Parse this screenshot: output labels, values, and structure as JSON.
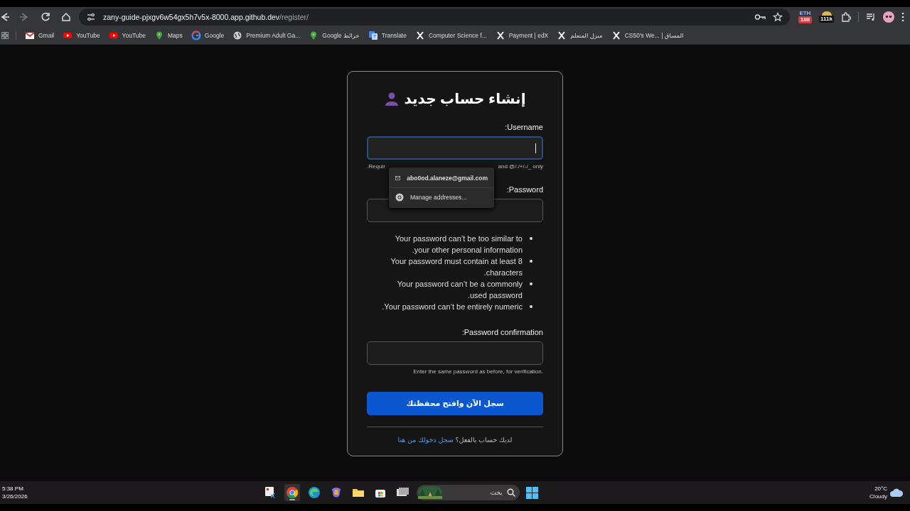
{
  "browser": {
    "nav_buttons": [
      {
        "kind": "back",
        "disabled": false
      },
      {
        "kind": "forward",
        "disabled": true
      },
      {
        "kind": "reload",
        "disabled": false
      },
      {
        "kind": "home",
        "disabled": false
      }
    ],
    "address": {
      "host": "zany-guide-pjxgv6w54gx5h7v5x-8000.app.github.dev",
      "path": "/register/"
    },
    "extensions": [
      {
        "kind": "eth",
        "label": "ETH",
        "badge": "188"
      },
      {
        "kind": "coin",
        "badge": "111k"
      }
    ],
    "bookmarks": [
      {
        "kind": "gmail",
        "label": "Gmail"
      },
      {
        "kind": "youtube",
        "label": "YouTube"
      },
      {
        "kind": "youtube",
        "label": "YouTube"
      },
      {
        "kind": "maps",
        "label": "Maps"
      },
      {
        "kind": "google",
        "label": "Google"
      },
      {
        "kind": "globe",
        "label": "Premium Adult Ga..."
      },
      {
        "kind": "maps",
        "label": "Google خرائط"
      },
      {
        "kind": "translate",
        "label": "Translate"
      },
      {
        "kind": "x",
        "label": "Computer Science f..."
      },
      {
        "kind": "x",
        "label": "Payment | edX"
      },
      {
        "kind": "x",
        "label": "منزل المتعلم"
      },
      {
        "kind": "x",
        "label": "CS50's We... | المساق"
      }
    ]
  },
  "form": {
    "title": "إنشاء حساب جديد",
    "username": {
      "label": "Username:",
      "focused": true,
      "help_left": ".Requir",
      "help_right": "and @/./+/-/_ only"
    },
    "autofill": [
      {
        "kind": "email",
        "label": "abo0od.alaneze@gmail.com"
      },
      {
        "kind": "manage",
        "label": "Manage addresses..."
      }
    ],
    "password": {
      "label": "Password:",
      "focused": false
    },
    "rules": [
      "Your password can’t be too similar to your other personal information.",
      "Your password must contain at least 8 characters.",
      "Your password can’t be a commonly used password.",
      "Your password can’t be entirely numeric."
    ],
    "confirm": {
      "label": "Password confirmation:",
      "focused": false,
      "help": "Enter the same password as before, for verification."
    },
    "submit": "سجل الآن وافتح محفظتك",
    "footer_text": "لديك حساب بالفعل؟",
    "footer_link": "سجل دخولك من هنا"
  },
  "taskbar": {
    "time": "5:38 PM",
    "date": "3/26/2026",
    "apps": [
      {
        "kind": "snip",
        "selected": false
      },
      {
        "kind": "chrome",
        "selected": true
      },
      {
        "kind": "edge",
        "selected": false
      },
      {
        "kind": "copilot",
        "selected": false
      },
      {
        "kind": "folder",
        "selected": false
      },
      {
        "kind": "store",
        "selected": false
      },
      {
        "kind": "window",
        "selected": false
      }
    ],
    "search_placeholder": "بحث",
    "temperature": "20°C",
    "weather": "Cloudy"
  }
}
